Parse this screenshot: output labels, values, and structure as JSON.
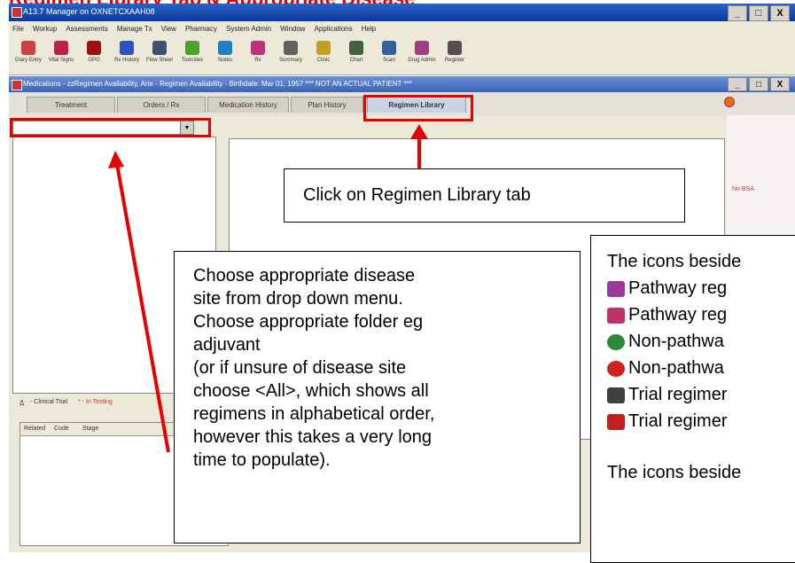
{
  "page_title": "Regimen Library Tab & Appropriate Disease",
  "app": {
    "title": "A13.7 Manager on OXNETCXAAH08",
    "window_buttons": [
      "_",
      "□",
      "X"
    ]
  },
  "menu": [
    "File",
    "Workup",
    "Assessments",
    "Manage Tx",
    "View",
    "Pharmacy",
    "System Admin",
    "Window",
    "Applications",
    "Help"
  ],
  "toolbar": [
    {
      "label": "Diary Entry",
      "icon": "diary-icon",
      "color": "#d04040"
    },
    {
      "label": "Vital Signs",
      "icon": "vital-signs-icon",
      "color": "#c02050"
    },
    {
      "label": "GPO",
      "icon": "gpo-icon",
      "color": "#a01010"
    },
    {
      "label": "Rx History",
      "icon": "rx-icon",
      "color": "#3050c0"
    },
    {
      "label": "Flow Sheet",
      "icon": "flowsheet-icon",
      "color": "#405070"
    },
    {
      "label": "Toxicities",
      "icon": "toxicity-icon",
      "color": "#50a030"
    },
    {
      "label": "Notes",
      "icon": "notes-icon",
      "color": "#2080c0"
    },
    {
      "label": "Rx",
      "icon": "rx2-icon",
      "color": "#c03080"
    },
    {
      "label": "Summary",
      "icon": "summary-icon",
      "color": "#606060"
    },
    {
      "label": "Clinic",
      "icon": "clinic-icon",
      "color": "#c0a020"
    },
    {
      "label": "Chart",
      "icon": "chart-icon",
      "color": "#406040"
    },
    {
      "label": "Scan",
      "icon": "scan-icon",
      "color": "#3060a0"
    },
    {
      "label": "Drug Admin",
      "icon": "drug-admin-icon",
      "color": "#a04080"
    },
    {
      "label": "Register",
      "icon": "register-icon",
      "color": "#505050"
    }
  ],
  "child_window": {
    "title": "Medications - zzRegimen Availability, Arie - Regimen Availability - Birthdate: Mar 01, 1957 *** NOT AN ACTUAL PATIENT ***",
    "window_buttons": [
      "_",
      "□",
      "X"
    ]
  },
  "tabs": [
    {
      "label": "Treatment",
      "active": false
    },
    {
      "label": "Orders / Rx",
      "active": false
    },
    {
      "label": "Medication History",
      "active": false
    },
    {
      "label": "Plan History",
      "active": false
    },
    {
      "label": "Regimen Library",
      "active": true
    }
  ],
  "combo": {
    "value": "",
    "arrow": "▼"
  },
  "no_bsa": "No BSA",
  "legend": {
    "clinical_trial": "- Clinical Trial",
    "in_testing": "* - In Testing",
    "ct_icon": "Δ"
  },
  "grid": {
    "columns": [
      "Related",
      "Code",
      "Stage"
    ]
  },
  "callouts": {
    "tab": "Click on Regimen Library tab",
    "choose": [
      "Choose appropriate disease",
      "site from drop down menu.",
      "Choose appropriate folder eg",
      "adjuvant",
      "(or if unsure of disease site",
      "choose <All>, which shows all",
      "regimens in alphabetical order,",
      "however this takes a very long",
      "time to populate)."
    ],
    "icons_heading": "The icons beside",
    "icons": [
      {
        "text": "Pathway reg",
        "icon": "pathway-regimen-icon",
        "color": "#9b3a9b"
      },
      {
        "text": "Pathway reg",
        "icon": "pathway-regimen-red-icon",
        "color": "#c0306a"
      },
      {
        "text": "Non-pathwa",
        "icon": "non-pathway-flask-icon",
        "color": "#2a8a3a"
      },
      {
        "text": "Non-pathwa",
        "icon": "non-pathway-flask-red-icon",
        "color": "#d02020"
      },
      {
        "text": "Trial regimer",
        "icon": "trial-regimen-icon",
        "color": "#404040"
      },
      {
        "text": "Trial regimer",
        "icon": "trial-regimen-red-icon",
        "color": "#c02020"
      }
    ],
    "icons_footer": "The icons beside"
  }
}
